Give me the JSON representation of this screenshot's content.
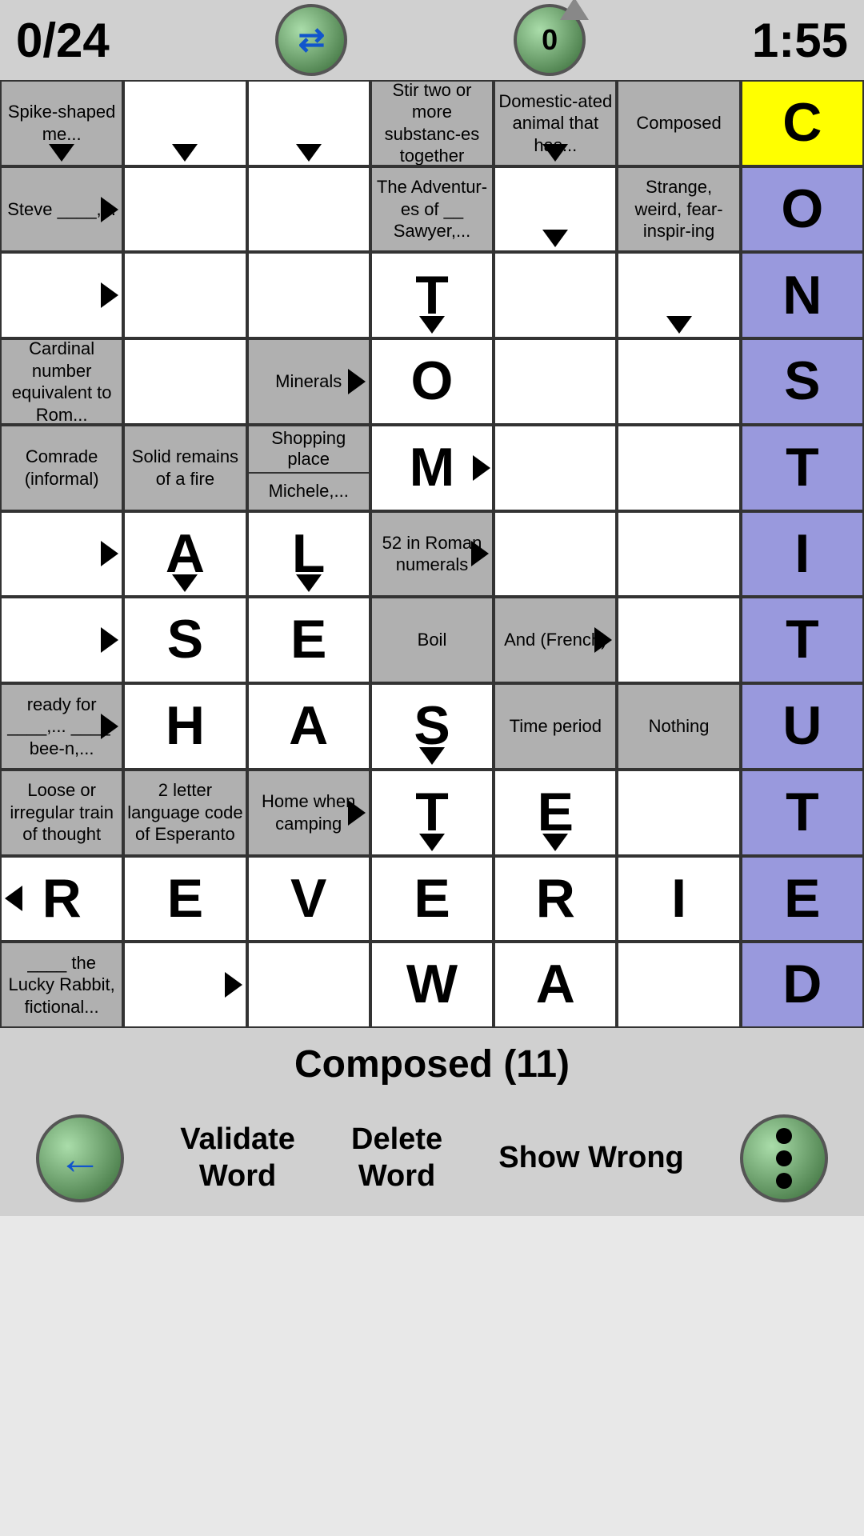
{
  "header": {
    "score": "0/24",
    "timer": "1:55",
    "swap_label": "⇄",
    "hint_count": "0"
  },
  "clue_bar": {
    "text": "Composed (11)"
  },
  "footer": {
    "validate_label": "Validate\nWord",
    "delete_label": "Delete\nWord",
    "show_wrong_label": "Show\nWrong"
  },
  "grid": {
    "rows": 11,
    "cols": 7
  }
}
